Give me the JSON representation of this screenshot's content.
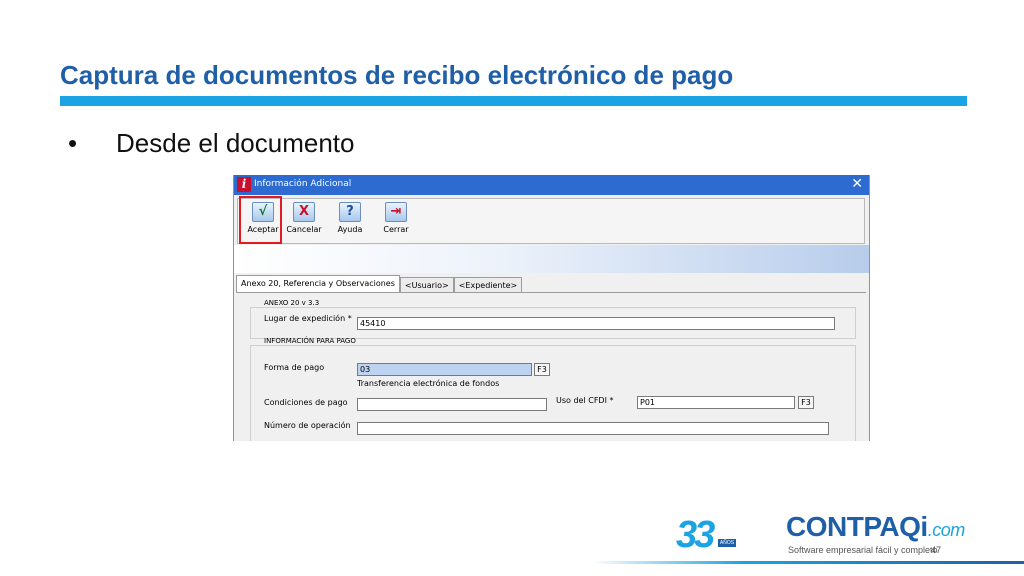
{
  "slide": {
    "title": "Captura de documentos de recibo electrónico de pago",
    "bullet_marker": "•",
    "bullet_text": "Desde el documento",
    "page_number": "47",
    "colors": {
      "title": "#1f5fa8",
      "accent_bar": "#1ba3e3",
      "highlight": "#e21b23"
    }
  },
  "dialog": {
    "title": "Información Adicional",
    "app_icon": "i",
    "close_glyph": "✕",
    "toolbar": [
      {
        "icon": "check-icon",
        "glyph": "√",
        "label": "Aceptar"
      },
      {
        "icon": "x-icon",
        "glyph": "X",
        "label": "Cancelar"
      },
      {
        "icon": "question-icon",
        "glyph": "?",
        "label": "Ayuda"
      },
      {
        "icon": "exit-door-icon",
        "glyph": "⇥",
        "label": "Cerrar"
      }
    ],
    "tabs": [
      {
        "label": "Anexo 20, Referencia y Observaciones",
        "active": true
      },
      {
        "label": "<Usuario>",
        "active": false
      },
      {
        "label": "<Expediente>",
        "active": false
      }
    ],
    "groups": {
      "anexo": {
        "title": "ANEXO 20 v 3.3",
        "lugar_label": "Lugar de expedición *",
        "lugar_value": "45410"
      },
      "pago": {
        "title": "INFORMACIÓN PARA PAGO",
        "forma_label": "Forma de pago",
        "forma_value": "03",
        "forma_description": "Transferencia electrónica de fondos",
        "f3": "F3",
        "condiciones_label": "Condiciones de pago",
        "condiciones_value": "",
        "uso_label": "Uso del CFDI *",
        "uso_value": "P01",
        "numero_label": "Número de operación",
        "numero_value": ""
      }
    }
  },
  "footer": {
    "anniversary": "33",
    "anniversary_tag": "AÑOS",
    "brand": "CONTPAQi",
    "brand_domain": ".com",
    "tagline": "Software empresarial fácil y completo"
  }
}
